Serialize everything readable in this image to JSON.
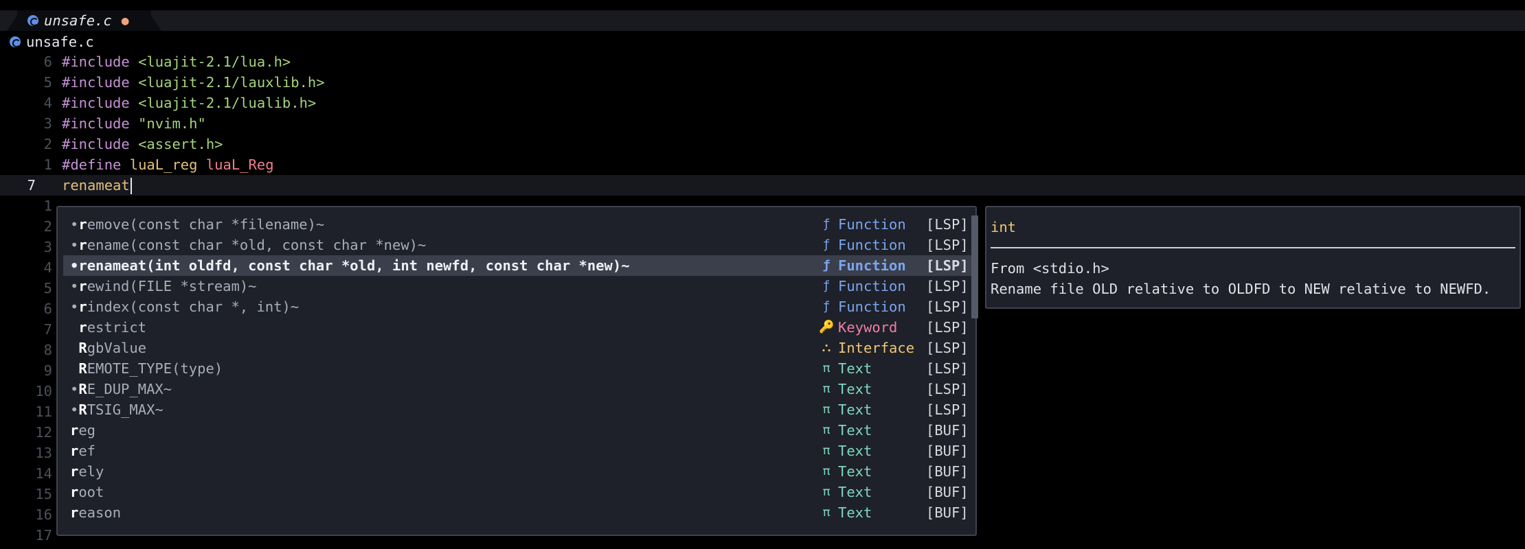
{
  "tabline": {
    "title": "unsafe.c",
    "modified_indicator": "●",
    "icon": "c-file-icon"
  },
  "winbar": {
    "title": "unsafe.c",
    "icon": "c-file-icon"
  },
  "editor": {
    "lines": [
      {
        "num": "6",
        "parts": [
          {
            "t": "#include ",
            "c": "kw"
          },
          {
            "t": "<luajit-2.1/lua.h>",
            "c": "str"
          }
        ]
      },
      {
        "num": "5",
        "parts": [
          {
            "t": "#include ",
            "c": "kw"
          },
          {
            "t": "<luajit-2.1/lauxlib.h>",
            "c": "str"
          }
        ]
      },
      {
        "num": "4",
        "parts": [
          {
            "t": "#include ",
            "c": "kw"
          },
          {
            "t": "<luajit-2.1/lualib.h>",
            "c": "str"
          }
        ]
      },
      {
        "num": "3",
        "parts": [
          {
            "t": "#include ",
            "c": "kw"
          },
          {
            "t": "\"nvim.h\"",
            "c": "str"
          }
        ]
      },
      {
        "num": "2",
        "parts": [
          {
            "t": "#include ",
            "c": "kw"
          },
          {
            "t": "<assert.h>",
            "c": "str"
          }
        ]
      },
      {
        "num": "1",
        "parts": [
          {
            "t": "#define ",
            "c": "kw"
          },
          {
            "t": "luaL_reg ",
            "c": "mac"
          },
          {
            "t": "luaL_Reg",
            "c": "mac2"
          }
        ]
      },
      {
        "num": "7",
        "current": true,
        "parts": [
          {
            "t": "renameat",
            "c": "mac"
          }
        ]
      },
      {
        "num": "1",
        "parts": []
      },
      {
        "num": "2",
        "parts": []
      },
      {
        "num": "3",
        "parts": []
      },
      {
        "num": "4",
        "parts": []
      },
      {
        "num": "5",
        "parts": []
      },
      {
        "num": "6",
        "parts": []
      },
      {
        "num": "7",
        "parts": []
      },
      {
        "num": "8",
        "parts": []
      },
      {
        "num": "9",
        "parts": []
      },
      {
        "num": "10",
        "parts": []
      },
      {
        "num": "11",
        "parts": []
      },
      {
        "num": "12",
        "parts": []
      },
      {
        "num": "13",
        "parts": []
      },
      {
        "num": "14",
        "parts": []
      },
      {
        "num": "15",
        "parts": []
      },
      {
        "num": "16",
        "parts": []
      },
      {
        "num": "17",
        "parts": []
      }
    ]
  },
  "completion": {
    "items": [
      {
        "dot": "•",
        "match": "r",
        "rest": "emove(const char *filename)~",
        "kind": "Function",
        "kind_icon": "ƒ",
        "kind_class": "k-fn",
        "source": "[LSP]"
      },
      {
        "dot": "•",
        "match": "r",
        "rest": "ename(const char *old, const char *new)~",
        "kind": "Function",
        "kind_icon": "ƒ",
        "kind_class": "k-fn",
        "source": "[LSP]"
      },
      {
        "dot": "•",
        "match": "r",
        "rest": "enameat(int oldfd, const char *old, int newfd, const char *new)~",
        "kind": "Function",
        "kind_icon": "ƒ",
        "kind_class": "k-fn",
        "source": "[LSP]",
        "selected": true
      },
      {
        "dot": "•",
        "match": "r",
        "rest": "ewind(FILE *stream)~",
        "kind": "Function",
        "kind_icon": "ƒ",
        "kind_class": "k-fn",
        "source": "[LSP]"
      },
      {
        "dot": "•",
        "match": "r",
        "rest": "index(const char *, int)~",
        "kind": "Function",
        "kind_icon": "ƒ",
        "kind_class": "k-fn",
        "source": "[LSP]"
      },
      {
        "dot": " ",
        "match": "r",
        "rest": "estrict",
        "kind": "Keyword",
        "kind_icon": "🔑",
        "kind_class": "k-kw",
        "source": "[LSP]"
      },
      {
        "dot": " ",
        "match": "R",
        "rest": "gbValue",
        "kind": "Interface",
        "kind_icon": "⛬",
        "kind_class": "k-if",
        "source": "[LSP]"
      },
      {
        "dot": " ",
        "match": "R",
        "rest": "EMOTE_TYPE(type)",
        "kind": "Text",
        "kind_icon": "π",
        "kind_class": "k-tx",
        "source": "[LSP]"
      },
      {
        "dot": "•",
        "match": "R",
        "rest": "E_DUP_MAX~",
        "kind": "Text",
        "kind_icon": " π",
        "kind_class": "k-tx",
        "source": "[LSP]"
      },
      {
        "dot": "•",
        "match": "R",
        "rest": "TSIG_MAX~",
        "kind": "Text",
        "kind_icon": "π",
        "kind_class": "k-tx",
        "source": "[LSP]"
      },
      {
        "dot": "",
        "match": "r",
        "rest": "eg",
        "kind": "Text",
        "kind_icon": "π",
        "kind_class": "k-tx",
        "source": "[BUF]"
      },
      {
        "dot": "",
        "match": "r",
        "rest": "ef",
        "kind": "Text",
        "kind_icon": "π",
        "kind_class": "k-tx",
        "source": "[BUF]"
      },
      {
        "dot": "",
        "match": "r",
        "rest": "ely",
        "kind": "Text",
        "kind_icon": "π",
        "kind_class": "k-tx",
        "source": "[BUF]"
      },
      {
        "dot": "",
        "match": "r",
        "rest": "oot",
        "kind": "Text",
        "kind_icon": "π",
        "kind_class": "k-tx",
        "source": "[BUF]"
      },
      {
        "dot": "",
        "match": "r",
        "rest": "eason",
        "kind": "Text",
        "kind_icon": "π",
        "kind_class": "k-tx",
        "source": "[BUF]"
      }
    ]
  },
  "docs": {
    "signature": "int",
    "from": "From <stdio.h>",
    "description": "Rename file OLD relative to OLDFD to NEW relative to NEWFD."
  }
}
